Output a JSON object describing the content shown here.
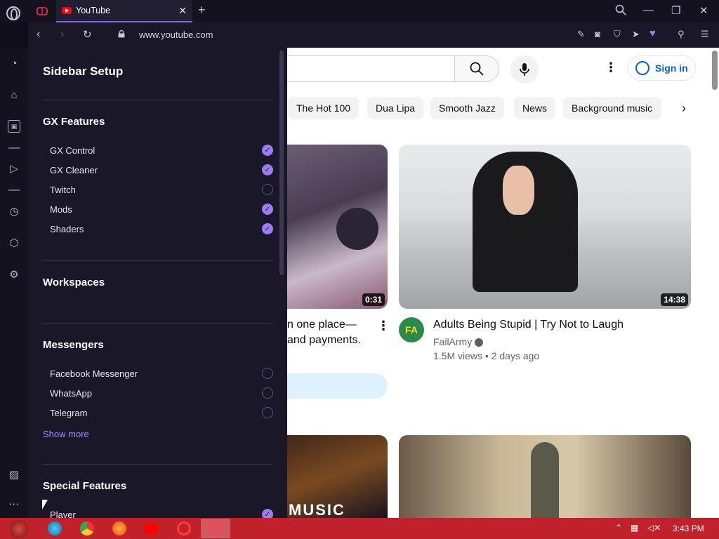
{
  "browser": {
    "tab_title": "YouTube",
    "new_tab_symbol": "+",
    "url": "www.youtube.com"
  },
  "sidebar_setup": {
    "title": "Sidebar Setup",
    "sections": [
      {
        "title": "GX Features",
        "items": [
          {
            "label": "GX Control",
            "checked": true
          },
          {
            "label": "GX Cleaner",
            "checked": true
          },
          {
            "label": "Twitch",
            "checked": false
          },
          {
            "label": "Mods",
            "checked": true
          },
          {
            "label": "Shaders",
            "checked": true
          }
        ]
      },
      {
        "title": "Workspaces",
        "items": []
      },
      {
        "title": "Messengers",
        "items": [
          {
            "label": "Facebook Messenger",
            "checked": false
          },
          {
            "label": "WhatsApp",
            "checked": false
          },
          {
            "label": "Telegram",
            "checked": false
          }
        ],
        "show_more": "Show more"
      },
      {
        "title": "Special Features",
        "items": [
          {
            "label": "Player",
            "checked": true
          }
        ]
      }
    ]
  },
  "youtube": {
    "sign_in": "Sign in",
    "chips": [
      "The Hot 100",
      "Dua Lipa",
      "Smooth Jazz",
      "News",
      "Background music"
    ],
    "videos": [
      {
        "duration": "0:31",
        "title_line1": "n one place—",
        "title_line2": "and payments."
      },
      {
        "duration": "14:38",
        "title": "Adults Being Stupid | Try Not to Laugh",
        "channel": "FailArmy",
        "avatar_text": "FA",
        "meta": "1.5M views • 2 days ago"
      }
    ],
    "bottom_left_thumb_text": "MUSIC"
  },
  "taskbar": {
    "time": "3:43 PM"
  },
  "colors": {
    "accent": "#9d7cf0",
    "panel_bg": "#1a1728",
    "taskbar": "#c0212a",
    "youtube_red": "#ff0000",
    "link_blue": "#065fd4"
  }
}
